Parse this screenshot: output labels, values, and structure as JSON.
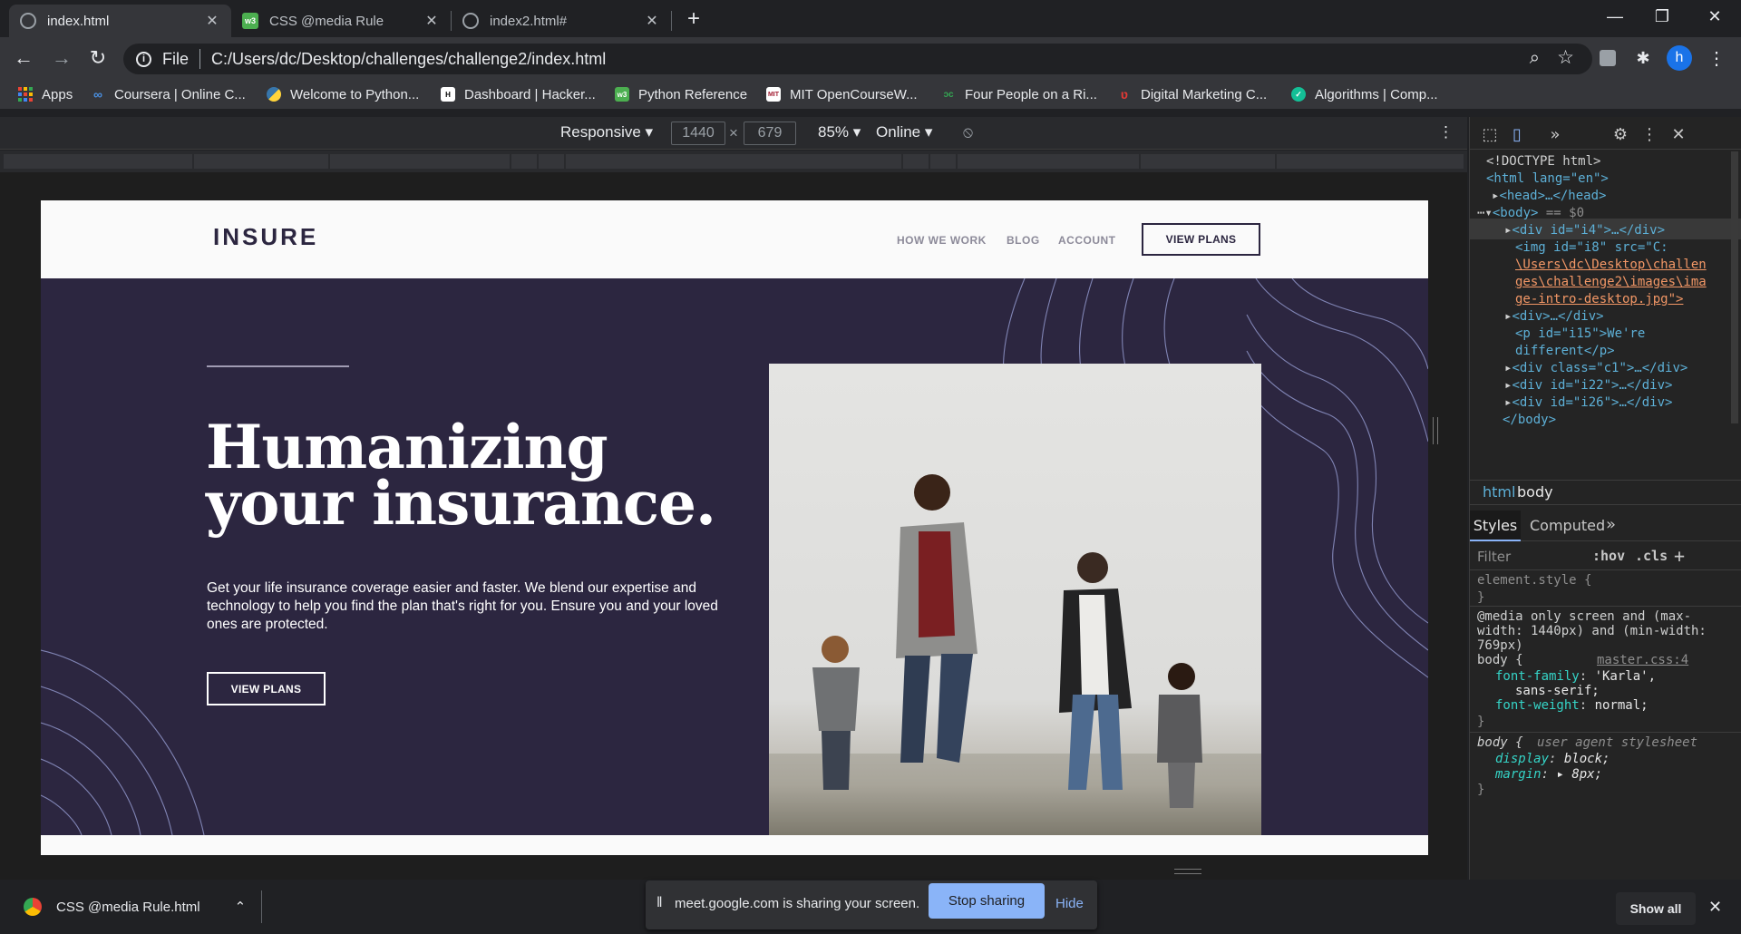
{
  "tabs": [
    {
      "label": "index.html"
    },
    {
      "label": "CSS @media Rule"
    },
    {
      "label": "index2.html#"
    }
  ],
  "window": {
    "minimize": "—",
    "restore": "❐",
    "close": "✕"
  },
  "omnibox": {
    "scheme_label": "File",
    "url": "C:/Users/dc/Desktop/challenges/challenge2/index.html"
  },
  "profile_initial": "h",
  "bookmarks": [
    {
      "label": "Apps"
    },
    {
      "label": "Coursera | Online C..."
    },
    {
      "label": "Welcome to Python..."
    },
    {
      "label": "Dashboard | Hacker..."
    },
    {
      "label": "Python Reference"
    },
    {
      "label": "MIT OpenCourseW..."
    },
    {
      "label": "Four People on a Ri..."
    },
    {
      "label": "Digital Marketing C..."
    },
    {
      "label": "Algorithms | Comp..."
    }
  ],
  "device_toolbar": {
    "mode": "Responsive",
    "width": "1440",
    "times": "×",
    "height": "679",
    "zoom": "85%",
    "network": "Online"
  },
  "site": {
    "logo": "INSURE",
    "nav": [
      "HOW WE WORK",
      "BLOG",
      "ACCOUNT"
    ],
    "cta_top": "VIEW PLANS",
    "hero_title_line1": "Humanizing",
    "hero_title_line2": "your insurance.",
    "hero_copy": "Get your life insurance coverage easier and faster. We blend our expertise and technology to help you find the plan that's right for you. Ensure you and your loved ones are protected.",
    "cta_hero": "VIEW PLANS"
  },
  "devtools": {
    "dom": {
      "doctype": "<!DOCTYPE html>",
      "html_open": "<html lang=\"en\">",
      "head": "<head>…</head>",
      "body_open": "<body>",
      "body_marker": "== $0",
      "div_i4": "<div id=\"i4\">…</div>",
      "img_i8_a": "<img id=\"i8\" src=\"C:",
      "img_i8_b": "\\Users\\dc\\Desktop\\challen",
      "img_i8_c": "ges\\challenge2\\images\\ima",
      "img_i8_d": "ge-intro-desktop.jpg\">",
      "div_anon": "<div>…</div>",
      "p_i15_a": "<p id=\"i15\">We're",
      "p_i15_b": "different</p>",
      "div_c1": "<div class=\"c1\">…</div>",
      "div_i22": "<div id=\"i22\">…</div>",
      "div_i26": "<div id=\"i26\">…</div>",
      "body_close": "</body>"
    },
    "breadcrumbs": [
      "html",
      "body"
    ],
    "style_tabs": [
      "Styles",
      "Computed"
    ],
    "filter_placeholder": "Filter",
    "hov": ":hov",
    "cls": ".cls",
    "rules": {
      "element_style": "element.style {",
      "close_brace": "}",
      "media_line1": "@media only screen and (max-",
      "media_line2": "width: 1440px) and (min-width:",
      "media_line3": "769px)",
      "selector_body": "body {",
      "source": "master.css:4",
      "font_family_prop": "font-family",
      "font_family_val": "'Karla',",
      "font_family_val2": "sans-serif;",
      "font_weight_prop": "font-weight",
      "font_weight_val": "normal;",
      "ua_selector": "body {",
      "ua_label": "user agent stylesheet",
      "display_prop": "display",
      "display_val": "block;",
      "margin_prop": "margin",
      "margin_val": "8px;"
    }
  },
  "download": {
    "filename": "CSS @media Rule.html",
    "show_all": "Show all"
  },
  "share_bar": {
    "message": "meet.google.com is sharing your screen.",
    "stop": "Stop sharing",
    "hide": "Hide"
  },
  "colors": {
    "hero_bg": "#2c2640",
    "accent": "#8ab4f8",
    "share_button": "#8ab4f8"
  }
}
